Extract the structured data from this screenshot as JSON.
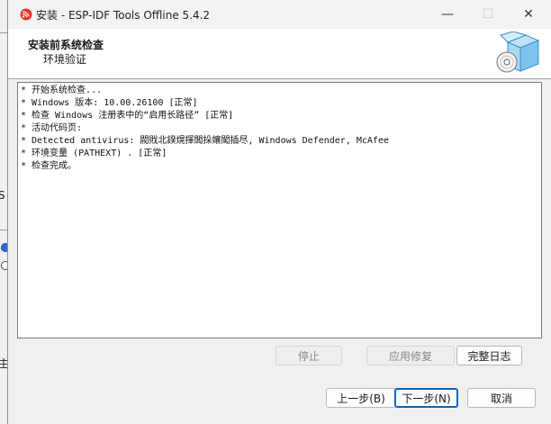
{
  "window": {
    "title": "安装 - ESP-IDF Tools Offline 5.4.2",
    "minimize_glyph": "—",
    "maximize_glyph": "☐",
    "close_glyph": "✕"
  },
  "header": {
    "title": "安装前系统检查",
    "subtitle": "环境验证"
  },
  "log": {
    "lines": [
      "* 开始系统检查...",
      "* Windows 版本: 10.00.26100 [正常]",
      "* 检查 Windows 注册表中的“启用长路径” [正常]",
      "* 活动代码页:",
      "* Detected antivirus: 閥戝北鍨熀揮闆挆孃闖插尽, Windows Defender, McAfee",
      "* 环境变量 (PATHEXT) . [正常]",
      "* 检查完成。"
    ]
  },
  "actions": {
    "stop_label": "停止",
    "apply_fix_label": "应用修复",
    "full_log_label": "完整日志"
  },
  "footer": {
    "back_label": "上一步(B)",
    "next_label": "下一步(N)",
    "cancel_label": "取消"
  },
  "background": {
    "edge_chars": [
      "主",
      "S"
    ]
  },
  "icons": {
    "app": "espressif-logo-icon",
    "header_art": "software-box-cd-icon"
  }
}
